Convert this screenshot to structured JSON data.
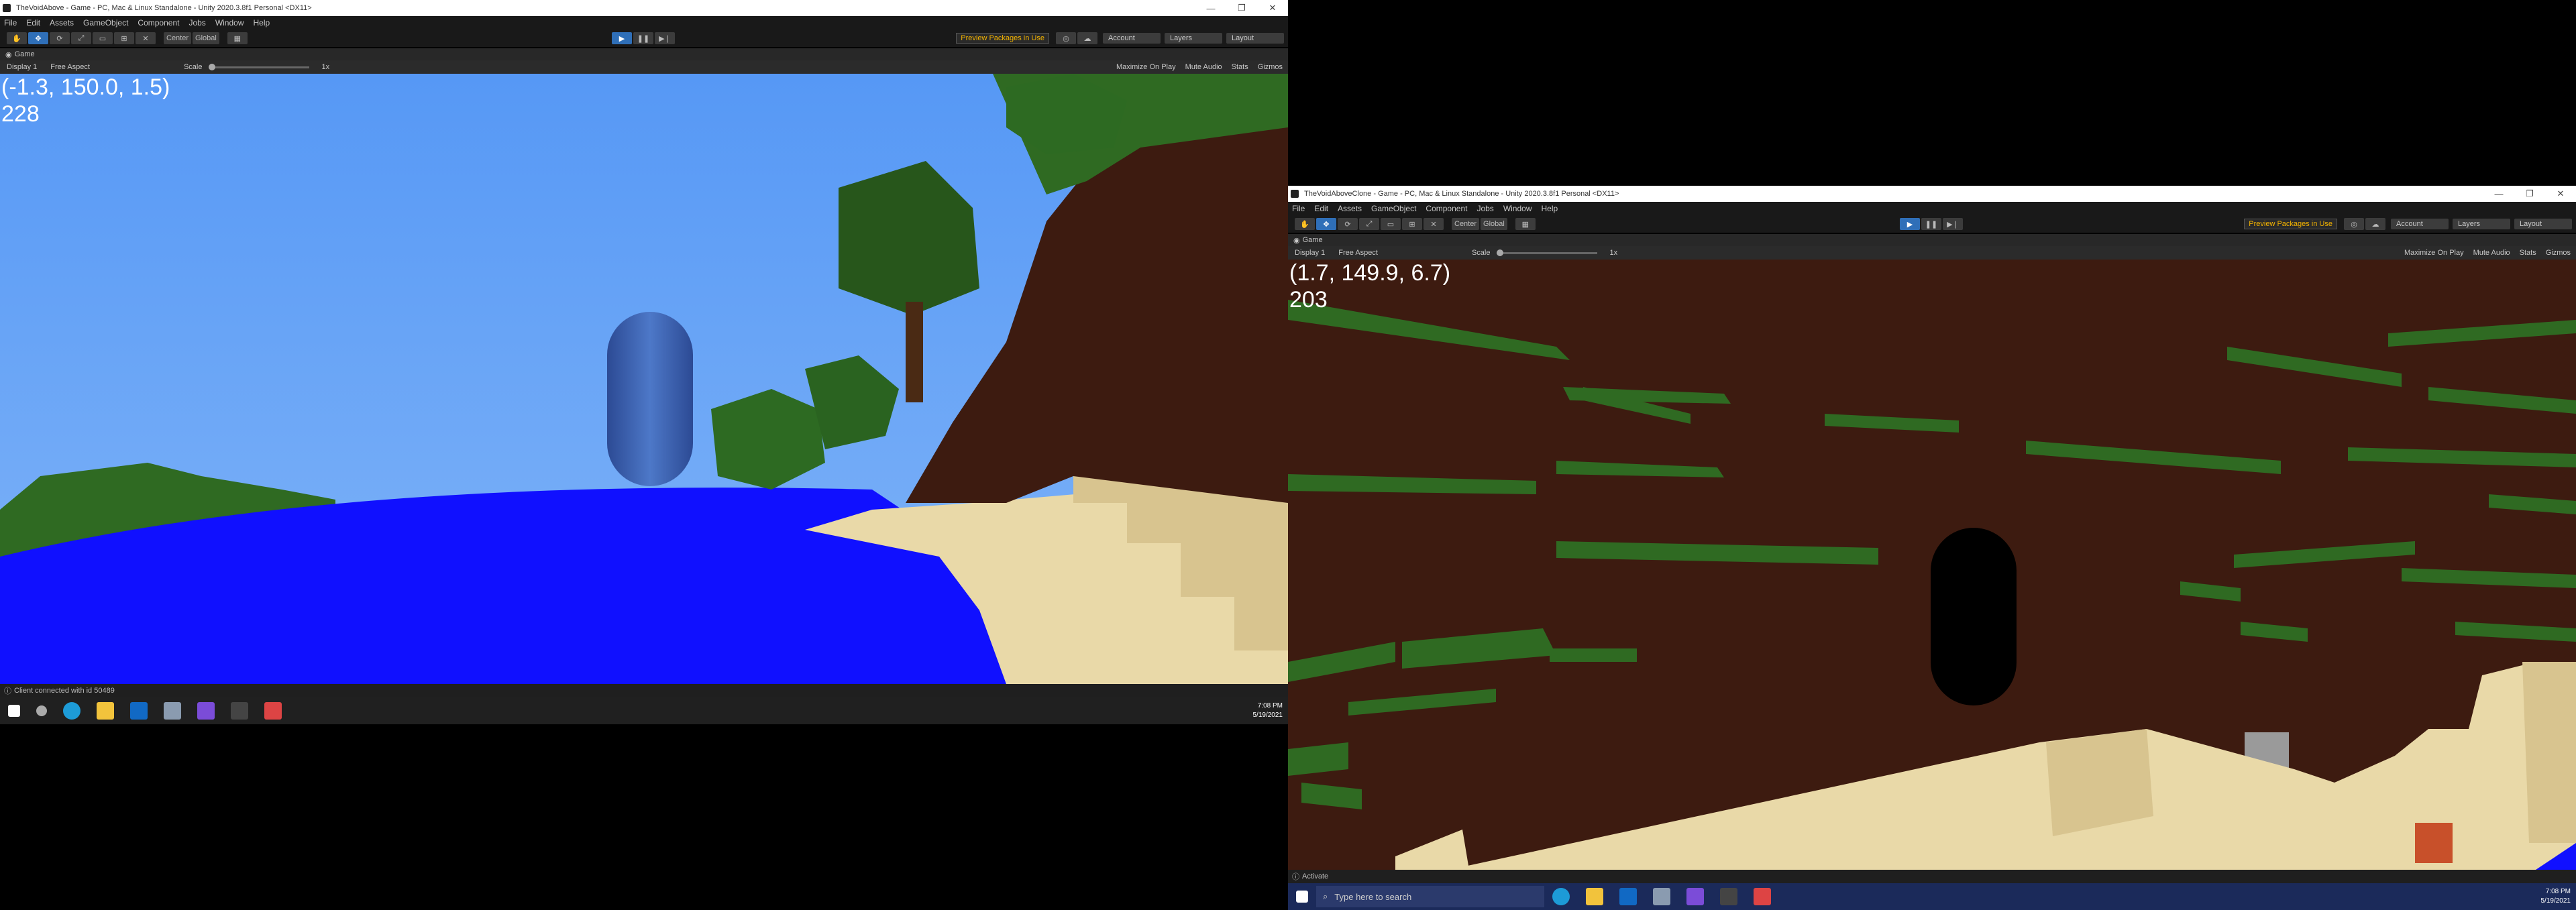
{
  "windows": [
    {
      "title": "TheVoidAbove - Game - PC, Mac & Linux Standalone - Unity 2020.3.8f1 Personal <DX11>",
      "hud_position": "(-1.3, 150.0, 1.5)",
      "hud_value": "228",
      "status": "Client connected with id 50489",
      "clock_time": "7:08 PM",
      "clock_date": "5/19/2021"
    },
    {
      "title": "TheVoidAboveClone - Game - PC, Mac & Linux Standalone - Unity 2020.3.8f1 Personal <DX11>",
      "hud_position": "(1.7, 149.9, 6.7)",
      "hud_value": "203",
      "status": "Activate",
      "search_placeholder": "Type here to search",
      "clock_time": "7:08 PM",
      "clock_date": "5/19/2021"
    }
  ],
  "menu": [
    "File",
    "Edit",
    "Assets",
    "GameObject",
    "Component",
    "Jobs",
    "Window",
    "Help"
  ],
  "toolbar": {
    "pivot": "Center",
    "space": "Global",
    "preview_packages": "Preview Packages in Use",
    "account": "Account",
    "layers": "Layers",
    "layout": "Layout"
  },
  "game_tab": "Game",
  "gamebar": {
    "display": "Display 1",
    "aspect": "Free Aspect",
    "scale_label": "Scale",
    "scale_value": "1x",
    "maximize": "Maximize On Play",
    "mute": "Mute Audio",
    "stats": "Stats",
    "gizmos": "Gizmos"
  },
  "colors": {
    "sky": "#5d9ef5",
    "water": "#1010ff",
    "sand": "#e9d9a8",
    "dirt": "#3d1b10",
    "leaves": "#2f6a22",
    "capsule_blue": "#3c64b4"
  }
}
